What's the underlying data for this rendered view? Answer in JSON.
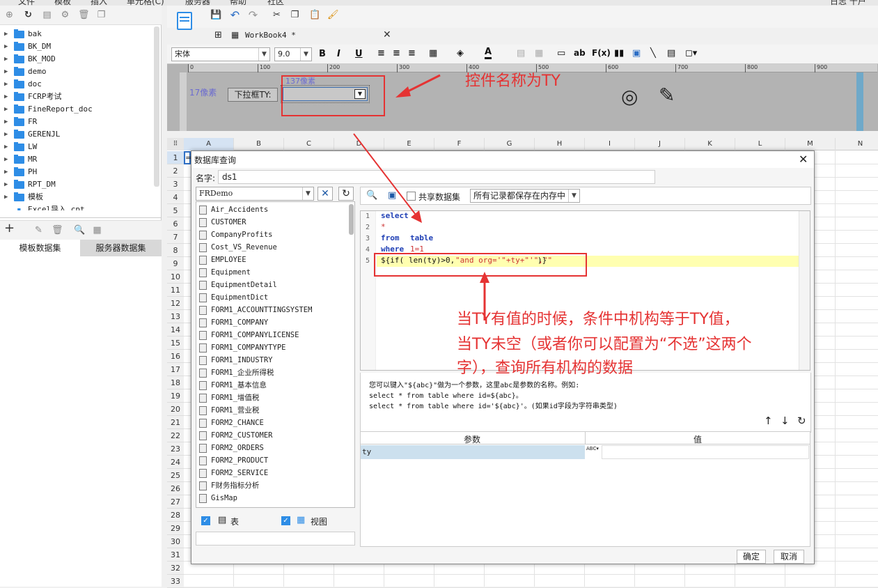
{
  "menubar": {
    "items": [
      "文件",
      "模板",
      "插入",
      "单元格(C)",
      "服务器",
      "帮助",
      "社区"
    ],
    "right": "日志  十户重。"
  },
  "tree": {
    "items": [
      "bak",
      "BK_DM",
      "BK_MOD",
      "demo",
      "doc",
      "FCRP考试",
      "FineReport_doc",
      "FR",
      "GERENJL",
      "LW",
      "MR",
      "PH",
      "RPT_DM",
      "模板",
      "Excel导入.cpt"
    ]
  },
  "dataset_tabs": {
    "template": "模板数据集",
    "server": "服务器数据集"
  },
  "workbook_tab": {
    "label": "WorkBook4 *"
  },
  "format": {
    "font": "宋体",
    "size": "9.0"
  },
  "param_pane": {
    "width_label": "137像素",
    "height_label": "17像素",
    "dropdown_label": "下拉框TY:",
    "ruler_ticks": [
      "0",
      "100",
      "200",
      "300",
      "400",
      "500",
      "600",
      "700",
      "800",
      "900"
    ]
  },
  "columns": [
    "A",
    "B",
    "C",
    "D",
    "E",
    "F",
    "G",
    "H",
    "I",
    "J",
    "K",
    "L",
    "M",
    "N"
  ],
  "rows": [
    "1",
    "2",
    "3",
    "4",
    "5",
    "6",
    "7",
    "8",
    "9",
    "10",
    "11",
    "12",
    "13",
    "14",
    "15",
    "16",
    "17",
    "18",
    "19",
    "20",
    "21",
    "22",
    "23",
    "24",
    "25",
    "26",
    "27",
    "28",
    "29",
    "30",
    "31",
    "32",
    "33"
  ],
  "cell_a1": "=",
  "dialog": {
    "title": "数据库查询",
    "name_label": "名字:",
    "name_value": "ds1",
    "connection": "FRDemo",
    "share_label": "共享数据集",
    "storage": "所有记录都保存在内存中",
    "tables": [
      "Air_Accidents",
      "CUSTOMER",
      "CompanyProfits",
      "Cost_VS_Revenue",
      "EMPLOYEE",
      "Equipment",
      "EquipmentDetail",
      "EquipmentDict",
      "FORM1_ACCOUNTTINGSYSTEM",
      "FORM1_COMPANY",
      "FORM1_COMPANYLICENSE",
      "FORM1_COMPANYTYPE",
      "FORM1_INDUSTRY",
      "FORM1_企业所得税",
      "FORM1_基本信息",
      "FORM1_增值税",
      "FORM1_营业税",
      "FORM2_CHANCE",
      "FORM2_CUSTOMER",
      "FORM2_ORDERS",
      "FORM2_PRODUCT",
      "FORM2_SERVICE",
      "F财务指标分析",
      "GisMap"
    ],
    "check_table": "表",
    "check_view": "视图",
    "sql_lines": [
      "1",
      "2",
      "3",
      "4",
      "5"
    ],
    "sql": {
      "l1": "select",
      "l2": "*",
      "l3_kw": "from",
      "l3_tbl": "table",
      "l4_kw": "where",
      "l4_val": "1=1",
      "l5_a": "${if(",
      "l5_b": "len(ty)>0,",
      "l5_c": "\"and org='\"+ty+\"'\",\"\"",
      "l5_d": ")}"
    },
    "hint1": "您可以键入\"${abc}\"做为一个参数，这里abc是参数的名称。例如:",
    "hint2": "select * from table where id=${abc}。",
    "hint3": "select * from table where id='${abc}'。(如果id字段为字符串类型)",
    "param_col": "参数",
    "value_col": "值",
    "param_name": "ty",
    "ok": "确定",
    "cancel": "取消"
  },
  "annotations": {
    "a1": "控件名称为TY",
    "a2_l1": "当TY有值的时候，条件中机构等于TY值，",
    "a2_l2": "当TY未空（或者你可以配置为“不选”这两个",
    "a2_l3": "字），查询所有机构的数据"
  },
  "colors": {
    "accent": "#2e8de6",
    "annotation": "#e53333",
    "highlight": "#ffffb0"
  }
}
